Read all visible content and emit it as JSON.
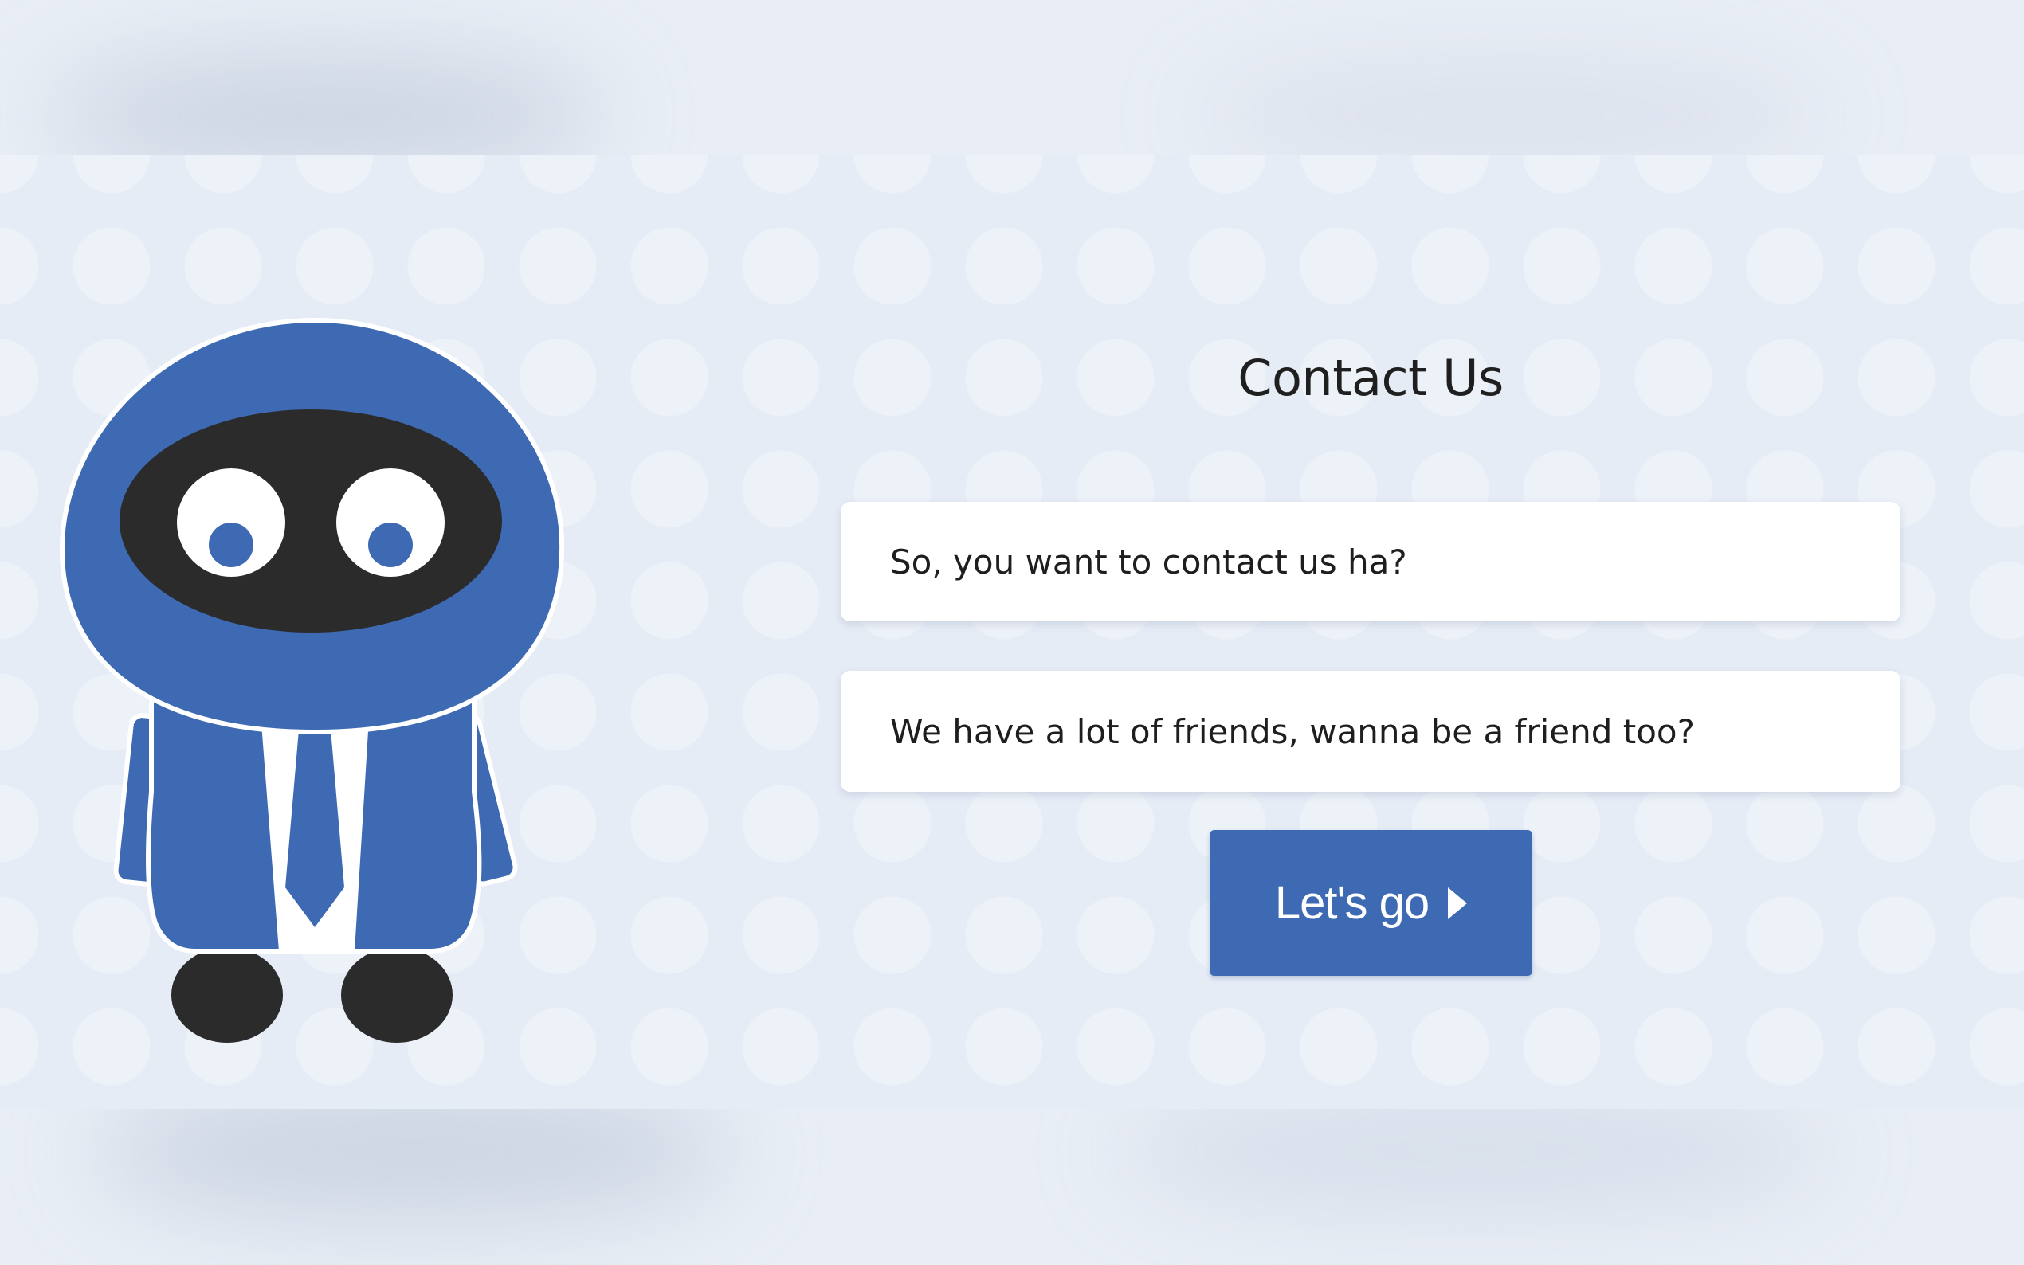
{
  "contact": {
    "title": "Contact Us",
    "line1": "So, you want to contact us ha?",
    "line2": "We have a lot of friends, wanna be a friend too?",
    "button_label": "Let's go",
    "button_icon": "caret-right-icon"
  },
  "mascot": {
    "name": "robot-mascot",
    "colors": {
      "body": "#3d6ab3",
      "visor": "#2b2b2b",
      "eye_white": "#ffffff",
      "feet": "#2b2b2b"
    }
  },
  "colors": {
    "page_background": "#e9eef6",
    "accent": "#3d6ab3",
    "card": "#ffffff",
    "text": "#1e1e1e"
  }
}
